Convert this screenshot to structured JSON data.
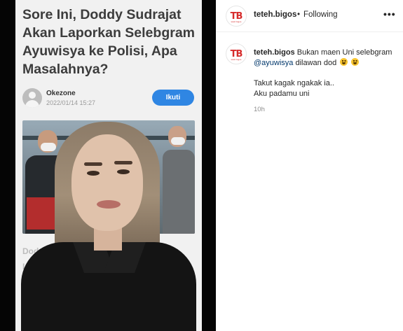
{
  "post_media": {
    "headline_lines": [
      "Sore Ini, Doddy Sudrajat",
      "Akan Laporkan Selebgram",
      "Ayuwisya ke Polisi, Apa",
      "Masalahnya?"
    ],
    "author": "Okezone",
    "date": "2022/01/14 15:27",
    "follow_button": "Ikuti",
    "below_lines": [
      "Dodd",
      "In"
    ]
  },
  "header": {
    "username": "teteh.bigos",
    "separator": "•",
    "follow_status": "Following",
    "more": "•••",
    "avatar_logo": "TB",
    "avatar_logo_sub": "teteh bigos"
  },
  "caption": {
    "username": "teteh.bigos",
    "text_before_mention": "Bukan maen Uni selebgram",
    "mention": "@ayuwisya",
    "text_after_mention": "dilawan dod",
    "line2": "Takut kagak ngakak ia..",
    "line3": "Aku padamu uni",
    "emoji": "grinning-face",
    "time": "10h"
  },
  "colors": {
    "follow_button": "#2f86e3",
    "mention": "#00376b",
    "logo": "#d62b2b",
    "muted": "#8e8e8e"
  }
}
